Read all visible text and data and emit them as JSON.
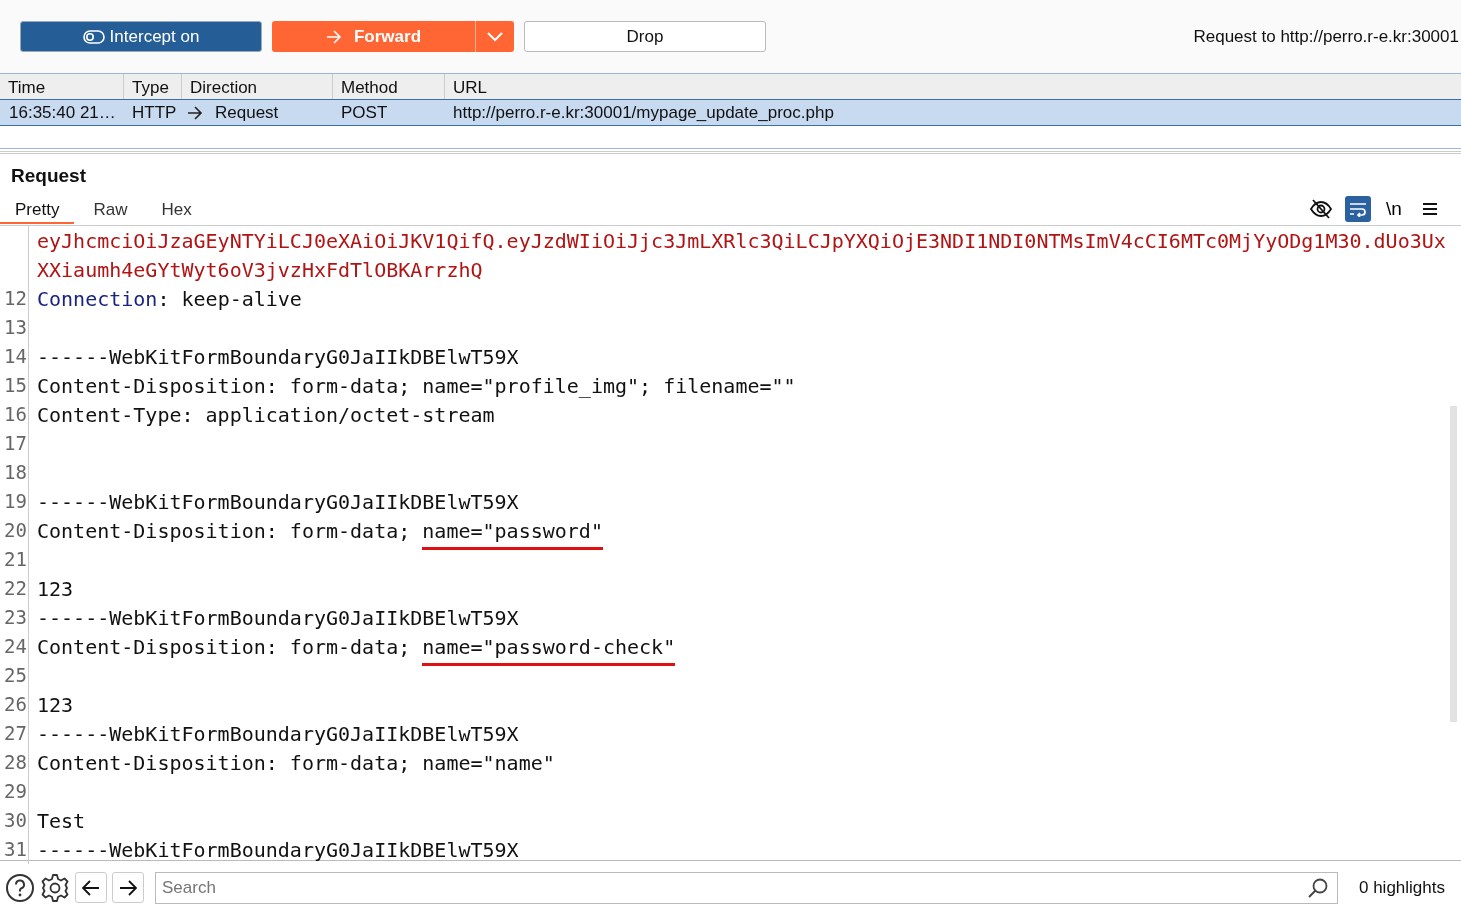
{
  "toolbar": {
    "intercept": {
      "label": "Intercept on",
      "on": true
    },
    "forward": {
      "label": "Forward"
    },
    "drop": {
      "label": "Drop"
    },
    "target": "Request to http://perro.r-e.kr:30001"
  },
  "table": {
    "columns": [
      "Time",
      "Type",
      "Direction",
      "Method",
      "URL"
    ],
    "rows": [
      {
        "time": "16:35:40 21…",
        "type": "HTTP",
        "direction": "Request",
        "method": "POST",
        "url": "http://perro.r-e.kr:30001/mypage_update_proc.php",
        "selected": true
      }
    ]
  },
  "request": {
    "title": "Request",
    "tabs": [
      {
        "label": "Pretty",
        "selected": true
      },
      {
        "label": "Raw",
        "selected": false
      },
      {
        "label": "Hex",
        "selected": false
      }
    ],
    "tools": {
      "hide": {
        "on": false
      },
      "wrap": {
        "on": true
      },
      "newline": "\\n"
    },
    "lines": [
      {
        "kind": "continuation",
        "text": "eyJhcmciOiJzaGEyNTYiLCJ0eXAiOiJKV1QifQ.eyJzdWIiOiJjc3JmLXRlc3QiLCJpYXQiOjE3NDI1NDI0NTMsImV4cCI6MTc0MjYyODg1M30.dUo3Ux"
      },
      {
        "kind": "continuation",
        "text": "XXiaumh4eGYtWyt6oV3jvzHxFdTlOBKArrzhQ"
      },
      {
        "number": "12",
        "kind": "header",
        "name": "Connection",
        "text": ": keep-alive"
      },
      {
        "number": "13",
        "kind": "plain"
      },
      {
        "number": "14",
        "kind": "plain",
        "text": "------WebKitFormBoundaryG0JaIIkDBElwT59X"
      },
      {
        "number": "15",
        "kind": "plain",
        "text": "Content-Disposition: form-data; name=\"profile_img\"; filename=\"\""
      },
      {
        "number": "16",
        "kind": "plain",
        "text": "Content-Type: application/octet-stream"
      },
      {
        "number": "17",
        "kind": "plain"
      },
      {
        "number": "18",
        "kind": "plain"
      },
      {
        "number": "19",
        "kind": "plain",
        "text": "------WebKitFormBoundaryG0JaIIkDBElwT59X"
      },
      {
        "number": "20",
        "kind": "plain",
        "text": "Content-Disposition: form-data; ",
        "marked": "name=\"password\""
      },
      {
        "number": "21",
        "kind": "plain"
      },
      {
        "number": "22",
        "kind": "plain",
        "text": "123"
      },
      {
        "number": "23",
        "kind": "plain",
        "text": "------WebKitFormBoundaryG0JaIIkDBElwT59X"
      },
      {
        "number": "24",
        "kind": "plain",
        "text": "Content-Disposition: form-data; ",
        "marked": "name=\"password-check\""
      },
      {
        "number": "25",
        "kind": "plain"
      },
      {
        "number": "26",
        "kind": "plain",
        "text": "123"
      },
      {
        "number": "27",
        "kind": "plain",
        "text": "------WebKitFormBoundaryG0JaIIkDBElwT59X"
      },
      {
        "number": "28",
        "kind": "plain",
        "text": "Content-Disposition: form-data; name=\"name\""
      },
      {
        "number": "29",
        "kind": "plain"
      },
      {
        "number": "30",
        "kind": "plain",
        "text": "Test"
      },
      {
        "number": "31",
        "kind": "plain",
        "text": "------WebKitFormBoundaryG0JaIIkDBElwT59X"
      }
    ]
  },
  "footer": {
    "search": {
      "placeholder": "Search"
    },
    "highlights": "0 highlights"
  }
}
